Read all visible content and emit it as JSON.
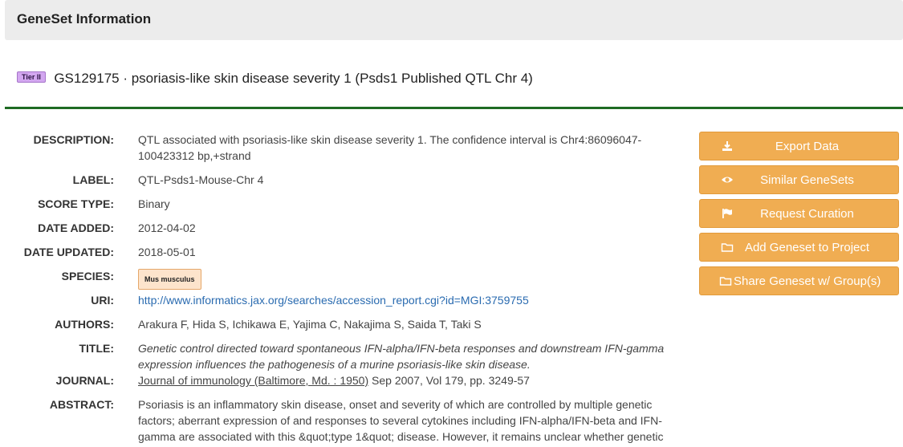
{
  "panel": {
    "title": "GeneSet Information"
  },
  "geneset": {
    "tier": "Tier II",
    "title": "GS129175 · psoriasis-like skin disease severity 1 (Psds1 Published QTL Chr 4)"
  },
  "labels": {
    "description": "DESCRIPTION:",
    "label": "LABEL:",
    "score_type": "SCORE TYPE:",
    "date_added": "DATE ADDED:",
    "date_updated": "DATE UPDATED:",
    "species": "SPECIES:",
    "uri": "URI:",
    "authors": "AUTHORS:",
    "title": "TITLE:",
    "journal": "JOURNAL:",
    "abstract": "ABSTRACT:"
  },
  "values": {
    "description_line1": "QTL associated with psoriasis-like skin disease severity 1. The confidence interval is Chr4:86096047-",
    "description_line2": "100423312 bp,+strand",
    "label": "QTL-Psds1-Mouse-Chr 4",
    "score_type": "Binary",
    "date_added": "2012-04-02",
    "date_updated": "2018-05-01",
    "species": "Mus musculus",
    "uri": "http://www.informatics.jax.org/searches/accession_report.cgi?id=MGI:3759755",
    "authors": "Arakura F, Hida S, Ichikawa E, Yajima C, Nakajima S, Saida T, Taki S",
    "title_line1": "Genetic control directed toward spontaneous IFN-alpha/IFN-beta responses and downstream IFN-gamma",
    "title_line2": "expression influences the pathogenesis of a murine psoriasis-like skin disease.",
    "journal_name": "Journal of immunology (Baltimore, Md. : 1950)",
    "journal_details": " Sep 2007, Vol 179, pp. 3249-57",
    "abstract_line1": "Psoriasis is an inflammatory skin disease, onset and severity of which are controlled by multiple genetic",
    "abstract_line2": "factors; aberrant expression of and responses to several cytokines including IFN-alpha/IFN-beta and IFN-",
    "abstract_line3": "gamma are associated with this &quot;type 1&quot; disease. However, it remains unclear whether genetic"
  },
  "actions": {
    "export": "Export Data",
    "similar": "Similar GeneSets",
    "curation": "Request Curation",
    "add_project": "Add Geneset to Project",
    "share": "Share Geneset w/ Group(s)"
  },
  "colors": {
    "accent_button": "#f0ad52",
    "divider": "#1e6b23",
    "tier_badge": "#d3a7f0",
    "species_badge": "#fde4cc",
    "link": "#2a6bb0"
  },
  "icons": [
    "download-icon",
    "eye-icon",
    "flag-icon",
    "folder-icon"
  ]
}
